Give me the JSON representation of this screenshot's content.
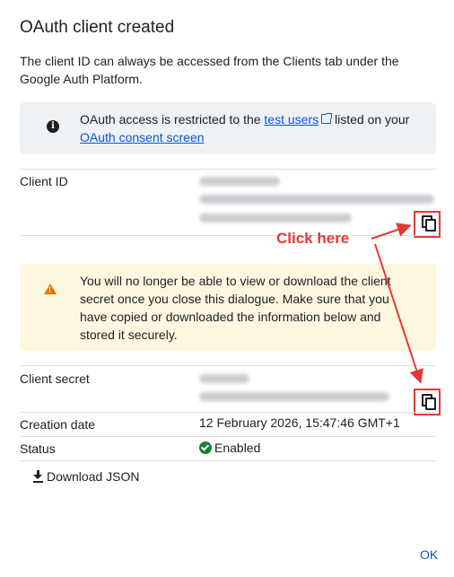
{
  "dialog": {
    "title": "OAuth client created",
    "description": "The client ID can always be accessed from the Clients tab under the Google Auth Platform.",
    "info": {
      "prefix": "OAuth access is restricted to the ",
      "link1": "test users",
      "middle": " listed on your ",
      "link2": "OAuth consent screen"
    },
    "client_id_label": "Client ID",
    "warning_text": "You will no longer be able to view or download the client secret once you close this dialogue. Make sure that you have copied or downloaded the information below and stored it securely.",
    "client_secret_label": "Client secret",
    "creation_date_label": "Creation date",
    "creation_date_value": "12 February 2026, 15:47:46 GMT+1",
    "status_label": "Status",
    "status_value": "Enabled",
    "download_label": "Download JSON",
    "ok_label": "OK"
  },
  "annotation": {
    "text": "Click here",
    "color": "#e53935"
  },
  "colors": {
    "accent": "#0b57d0",
    "warning": "#e37400",
    "success": "#188038"
  },
  "icons": [
    "info-icon",
    "external-link-icon",
    "copy-icon",
    "warning-icon",
    "check-circle-icon",
    "download-icon"
  ]
}
